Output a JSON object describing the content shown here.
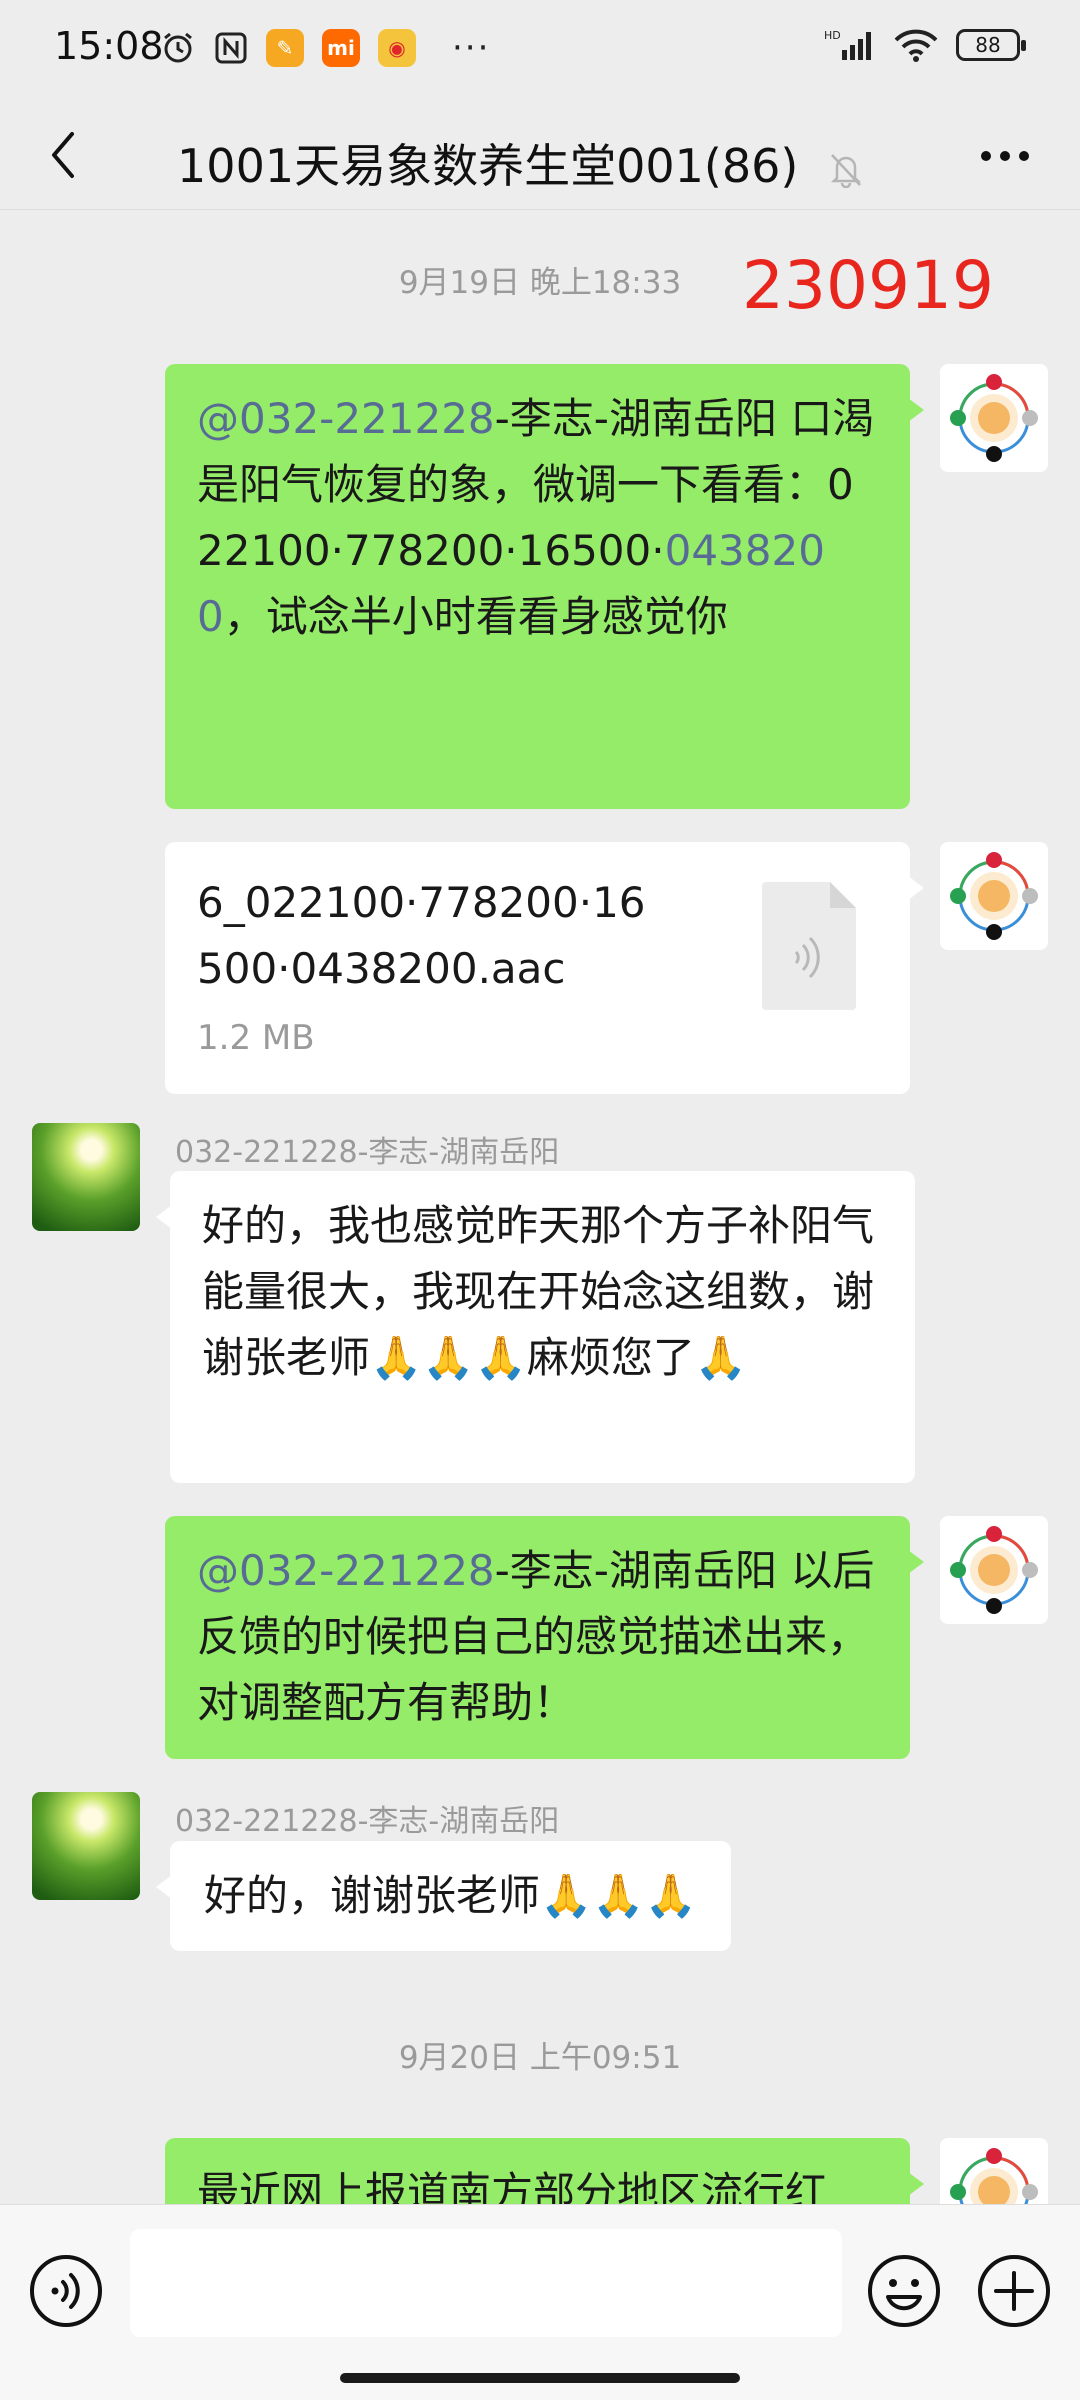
{
  "status_bar": {
    "time": "15:08",
    "network": "HD",
    "battery": "88",
    "overflow": "···"
  },
  "header": {
    "title": "1001天易象数养生堂001(86)"
  },
  "messages": {
    "ts1": "9月19日 晚上18:33",
    "stamp_number": "230919",
    "m1_mention": "@032-221228",
    "m1_text_a": "-李志-湖南岳阳  口渴是阳气恢复的象，微调一下看看：022100·778200·16500·",
    "m1_num": "0438200",
    "m1_text_b": "，试念半小时看看身感觉你",
    "file_name": "6_022100·778200·16500·0438200.aac",
    "file_size": "1.2 MB",
    "sender_a": "032-221228-李志-湖南岳阳",
    "m2_text": "好的，我也感觉昨天那个方子补阳气能量很大，我现在开始念这组数，谢谢张老师🙏🙏🙏麻烦您了🙏",
    "m3_mention": "@032-221228",
    "m3_text": "-李志-湖南岳阳  以后反馈的时候把自己的感觉描述出来，对调整配方有帮助！",
    "sender_b": "032-221228-李志-湖南岳阳",
    "m4_text": "好的，谢谢张老师🙏🙏🙏",
    "ts2": "9月20日 上午09:51",
    "m5_text": "最近网上报道南方部分地区流行红"
  },
  "colors": {
    "bubble_me": "#95ec69",
    "mention": "#576b95",
    "stamp": "#e8261e"
  },
  "icons": [
    "alarm-icon",
    "nfc-icon",
    "app-icon",
    "mi-icon",
    "weibo-icon",
    "signal-icon",
    "wifi-icon",
    "battery-icon",
    "back-icon",
    "mute-icon",
    "more-icon",
    "audio-file-icon",
    "voice-icon",
    "emoji-icon",
    "plus-icon"
  ]
}
